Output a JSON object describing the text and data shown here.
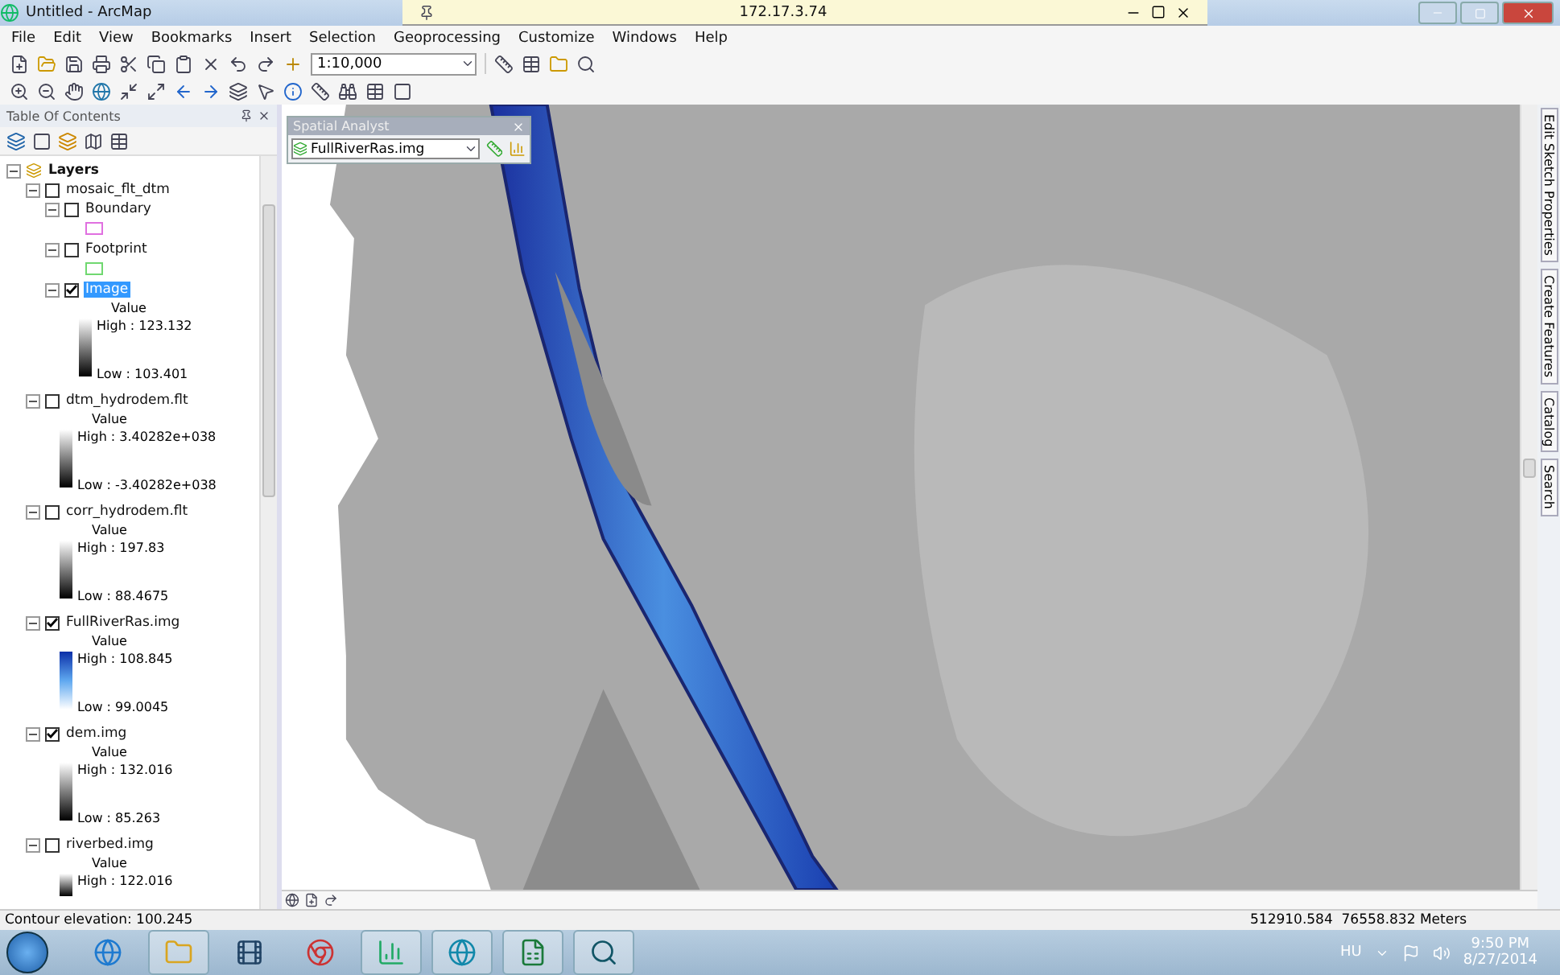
{
  "window": {
    "title": "Untitled - ArcMap"
  },
  "remote_bar": {
    "address": "172.17.3.74"
  },
  "menu": [
    "File",
    "Edit",
    "View",
    "Bookmarks",
    "Insert",
    "Selection",
    "Geoprocessing",
    "Customize",
    "Windows",
    "Help"
  ],
  "toolbar": {
    "scale": "1:10,000"
  },
  "toc": {
    "title": "Table Of Contents",
    "root": {
      "label": "Layers",
      "expanded": true,
      "children": [
        {
          "label": "mosaic_flt_dtm",
          "checked": false,
          "selected": false,
          "expanded": true,
          "children": [
            {
              "label": "Boundary",
              "checked": false,
              "selected": false,
              "expanded": true,
              "legend": {
                "kind": "outline",
                "color": "#e070e0"
              }
            },
            {
              "label": "Footprint",
              "checked": false,
              "selected": false,
              "expanded": true,
              "legend": {
                "kind": "outline",
                "color": "#70d870"
              }
            },
            {
              "label": "Image",
              "checked": true,
              "selected": true,
              "expanded": true,
              "legend": {
                "kind": "gray_ramp",
                "heading": "Value",
                "high": "High : 123.132",
                "low": "Low : 103.401"
              }
            }
          ]
        },
        {
          "label": "dtm_hydrodem.flt",
          "checked": false,
          "selected": false,
          "expanded": true,
          "legend": {
            "kind": "gray_ramp",
            "heading": "Value",
            "high": "High : 3.40282e+038",
            "low": "Low : -3.40282e+038"
          }
        },
        {
          "label": "corr_hydrodem.flt",
          "checked": false,
          "selected": false,
          "expanded": true,
          "legend": {
            "kind": "gray_ramp",
            "heading": "Value",
            "high": "High : 197.83",
            "low": "Low : 88.4675"
          }
        },
        {
          "label": "FullRiverRas.img",
          "checked": true,
          "selected": false,
          "expanded": true,
          "legend": {
            "kind": "blue_ramp",
            "heading": "Value",
            "high": "High : 108.845",
            "low": "Low : 99.0045"
          }
        },
        {
          "label": "dem.img",
          "checked": true,
          "selected": false,
          "expanded": true,
          "legend": {
            "kind": "gray_ramp",
            "heading": "Value",
            "high": "High : 132.016",
            "low": "Low : 85.263"
          }
        },
        {
          "label": "riverbed.img",
          "checked": false,
          "selected": false,
          "expanded": true,
          "legend": {
            "kind": "gray_ramp",
            "heading": "Value",
            "high": "High : 122.016"
          }
        }
      ]
    }
  },
  "spatial_analyst": {
    "title": "Spatial Analyst",
    "layer": "FullRiverRas.img"
  },
  "dock_tabs": [
    "Edit Sketch Properties",
    "Create Features",
    "Catalog",
    "Search"
  ],
  "status_bar": {
    "message": "Contour elevation: 100.245",
    "coordinates": "512910.584  76558.832 Meters"
  },
  "taskbar": {
    "language": "HU",
    "time": "9:50 PM",
    "date": "8/27/2014"
  }
}
